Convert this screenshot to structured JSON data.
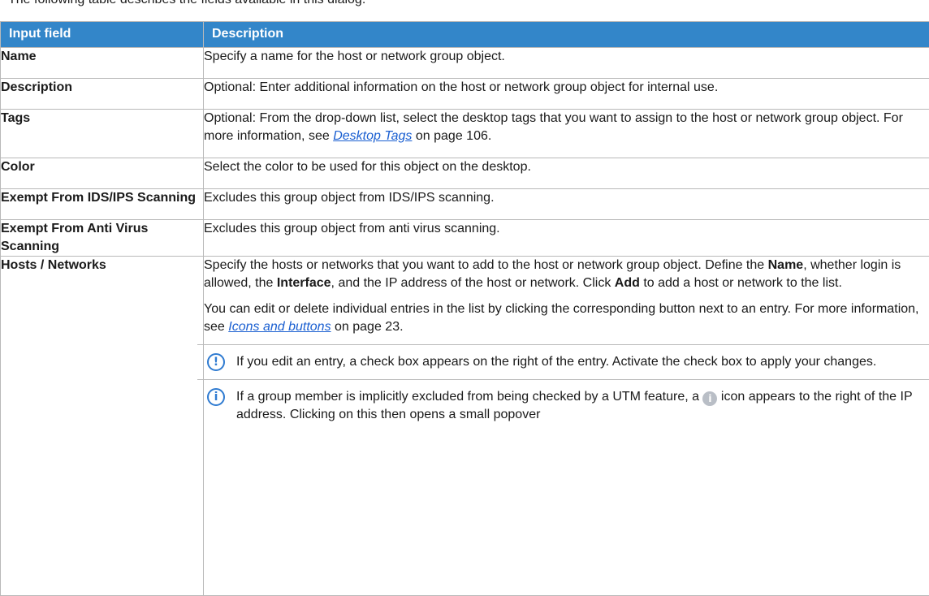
{
  "clipped_top_text": "The following table describes the fields available in this dialog.",
  "table": {
    "headers": [
      "Input field",
      "Description"
    ],
    "rows": {
      "name": {
        "field": "Name",
        "desc": "Specify a name for the host or network group object."
      },
      "description": {
        "field": "Description",
        "desc": "Optional: Enter additional information on the host or network group object for internal use."
      },
      "tags": {
        "field": "Tags",
        "desc_pre": "Optional: From the drop-down list, select the desktop tags that you want to assign to the host or network group object. For more information, see ",
        "link": "Desktop Tags",
        "desc_post": " on page 106."
      },
      "color": {
        "field": "Color",
        "desc": "Select the color to be used for this object on the desktop."
      },
      "ids": {
        "field": "Exempt From IDS/IPS Scanning",
        "desc": "Excludes this group object from IDS/IPS scanning."
      },
      "av": {
        "field": "Exempt From Anti Virus Scanning",
        "desc": "Excludes this group object from anti virus scanning."
      },
      "hosts": {
        "field": "Hosts / Networks",
        "p1_a": "Specify the hosts or networks that you want to add to the host or network group object. Define the ",
        "p1_name": "Name",
        "p1_b": ", whether login is allowed, the ",
        "p1_interface": "Interface",
        "p1_c": ", and the IP address of the host or network. Click ",
        "p1_add": "Add",
        "p1_d": " to add a host or network to the list.",
        "p2_a": "You can edit or delete individual entries in the list by clicking the corresponding button next to an entry. For more information, see ",
        "p2_link": "Icons and buttons",
        "p2_b": " on page 23.",
        "note1_icon": "!",
        "note1": "If you edit an entry, a check box appears on the right of the entry. Activate the check box to apply your changes.",
        "note2_icon": "i",
        "note2_a": "If a group member is implicitly excluded from being checked by a UTM feature, a ",
        "note2_inline_icon": "i",
        "note2_b": " icon appears to the right of the IP address. Clicking on this then opens a small popover"
      }
    }
  },
  "colors": {
    "header_bg": "#3386c9",
    "link": "#1a5fd1",
    "note_icon": "#2f7bd1",
    "border": "#b9b9b9"
  },
  "icons": {
    "note1": "exclamation-circle-icon",
    "note2": "info-circle-icon",
    "inline": "info-filled-icon"
  }
}
